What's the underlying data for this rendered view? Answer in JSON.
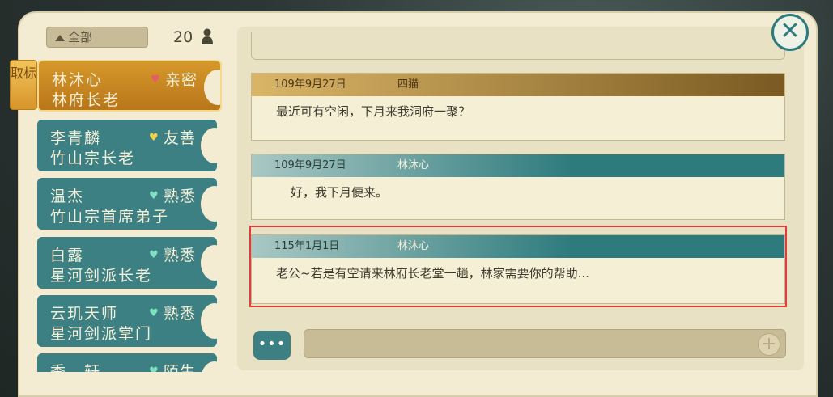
{
  "filter": {
    "label": "全部"
  },
  "friend_count": "20",
  "selected_tag": "取标",
  "friends": [
    {
      "name": "林沐心",
      "relation": "亲密",
      "heart_color": "#e85a6a",
      "title": "林府长老",
      "selected": true
    },
    {
      "name": "李青麟",
      "relation": "友善",
      "heart_color": "#f2d14a",
      "title": "竹山宗长老"
    },
    {
      "name": "温杰",
      "relation": "熟悉",
      "heart_color": "#7fe0c3",
      "title": "竹山宗首席弟子"
    },
    {
      "name": "白露",
      "relation": "熟悉",
      "heart_color": "#7fe0c3",
      "title": "星河剑派长老"
    },
    {
      "name": "云玑天师",
      "relation": "熟悉",
      "heart_color": "#7fe0c3",
      "title": "星河剑派掌门"
    },
    {
      "name": "季　轩",
      "relation": "陌生",
      "heart_color": "#7fe0c3",
      "title": ""
    }
  ],
  "messages": [
    {
      "date": "109年9月27日",
      "sender": "四猫",
      "text": "最近可有空闲，下月来我洞府一聚？"
    },
    {
      "date": "109年9月27日",
      "sender": "林沐心",
      "text": "好，我下月便来。"
    },
    {
      "date": "115年1月1日",
      "sender": "林沐心",
      "text": "老公~若是有空请来林府长老堂一趟，林家需要你的帮助..."
    }
  ],
  "chat_button": "•••",
  "input": {
    "placeholder": ""
  }
}
